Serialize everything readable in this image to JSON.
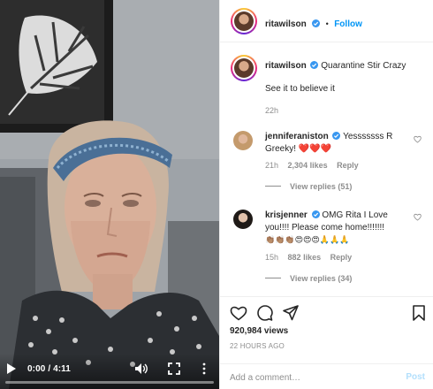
{
  "post": {
    "author": "ritawilson",
    "follow_label": "Follow",
    "separator": "•",
    "caption": {
      "username": "ritawilson",
      "line1": "Quarantine Stir Crazy",
      "line2": "See it to believe it",
      "time": "22h"
    },
    "comments": [
      {
        "username": "jenniferaniston",
        "text1": "Yesssssss R",
        "text2": "Greeky! ❤️❤️❤️",
        "time": "21h",
        "likes": "2,304 likes",
        "reply": "Reply",
        "view_replies": "View replies (51)"
      },
      {
        "username": "krisjenner",
        "text1": "OMG Rita I Love",
        "text2": "you!!!! Please come home!!!!!!!",
        "text3": "👏🏽👏🏽👏🏽😍😍😍🙏🙏🙏",
        "time": "15h",
        "likes": "882 likes",
        "reply": "Reply",
        "view_replies": "View replies (34)"
      }
    ],
    "views": "920,984 views",
    "posted_ago": "22 HOURS AGO",
    "comment_placeholder": "Add a comment…",
    "post_label": "Post"
  },
  "video": {
    "current_time": "0:00",
    "duration": "4:11",
    "time_separator": "/",
    "progress": 0.0
  },
  "icons": {
    "play": "play-icon",
    "volume": "volume-icon",
    "fullscreen": "fullscreen-icon",
    "more": "more-vertical-icon",
    "verified": "verified-badge-icon",
    "heart": "heart-icon",
    "comment": "comment-icon",
    "share": "share-icon",
    "save": "bookmark-icon"
  },
  "colors": {
    "link_blue": "#0095f6",
    "verified_blue": "#3897f0",
    "muted_text": "#8e8e8e",
    "post_disabled": "#b2dffc"
  }
}
